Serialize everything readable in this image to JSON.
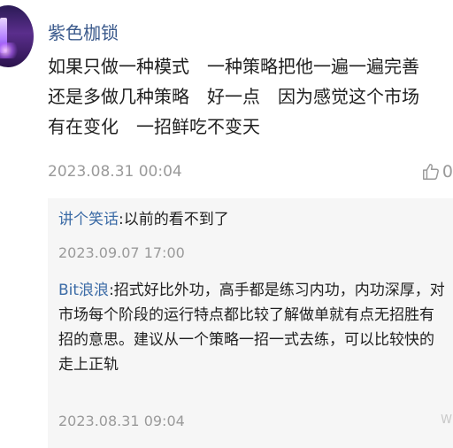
{
  "comment": {
    "author": "紫色枷锁",
    "text": "如果只做一种模式　一种策略把他一遍一遍完善\n还是多做几种策略　好一点　因为感觉这个市场\n有在变化　一招鲜吃不变天",
    "timestamp": "2023.08.31 00:04",
    "like_count": "0",
    "like_icon": "thumbs-up-icon"
  },
  "replies": [
    {
      "author": "讲个笑话",
      "separator": ":",
      "text": "以前的看不到了",
      "timestamp": "2023.09.07 17:00"
    },
    {
      "author": "Bit浪浪",
      "separator": ":",
      "text": "招式好比外功，高手都是练习内功，内功深厚，对市场每个阶段的运行特点都比较了解做单就有点无招胜有招的意思。建议从一个策略一招一式去练，可以比较快的走上正轨",
      "timestamp": "2023.08.31 09:04"
    }
  ],
  "watermark": "W"
}
